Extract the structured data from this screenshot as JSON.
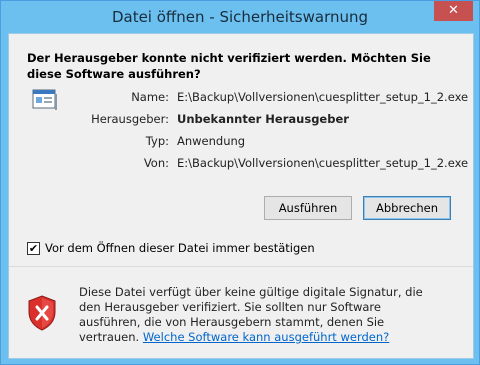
{
  "window": {
    "title": "Datei öffnen - Sicherheitswarnung",
    "close_glyph": "✕"
  },
  "headline": "Der Herausgeber konnte nicht verifiziert werden. Möchten Sie diese Software ausführen?",
  "details": {
    "name_label": "Name:",
    "name_value": "E:\\Backup\\Vollversionen\\cuesplitter_setup_1_2.exe",
    "publisher_label": "Herausgeber:",
    "publisher_value": "Unbekannter Herausgeber",
    "type_label": "Typ:",
    "type_value": "Anwendung",
    "from_label": "Von:",
    "from_value": "E:\\Backup\\Vollversionen\\cuesplitter_setup_1_2.exe"
  },
  "buttons": {
    "run": "Ausführen",
    "cancel": "Abbrechen"
  },
  "checkbox": {
    "label": "Vor dem Öffnen dieser Datei immer bestätigen",
    "checked": true,
    "check_glyph": "✔"
  },
  "footer": {
    "text": "Diese Datei verfügt über keine gültige digitale Signatur, die den Herausgeber verifiziert. Sie sollten nur Software ausführen, die von Herausgebern stammt, denen Sie vertrauen.",
    "link": "Welche Software kann ausgeführt werden?"
  },
  "icons": {
    "app": "application-icon",
    "warning": "security-shield-error-icon"
  },
  "colors": {
    "titlebar": "#6cc0f0",
    "close": "#c75050",
    "link": "#0066cc",
    "shield": "#d9302c"
  }
}
